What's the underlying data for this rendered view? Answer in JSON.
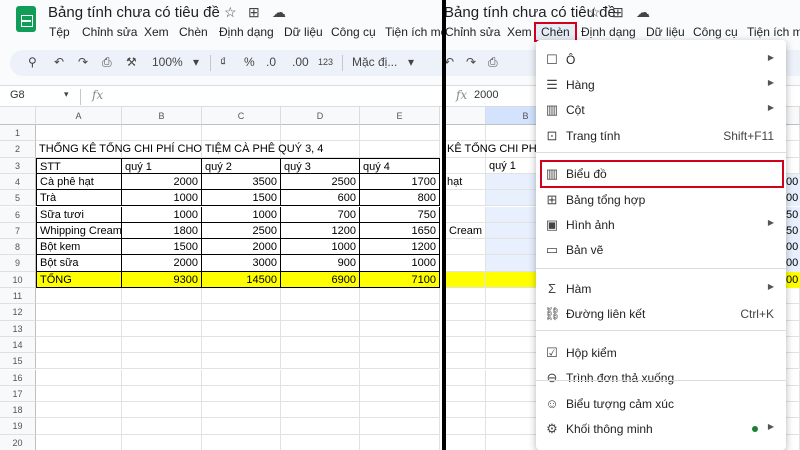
{
  "doc_title": "Bảng tính chưa có tiêu đề",
  "menu": [
    "Tệp",
    "Chỉnh sửa",
    "Xem",
    "Chèn",
    "Định dạng",
    "Dữ liệu",
    "Công cụ",
    "Tiện ích mở"
  ],
  "toolbar": {
    "zoom": "100%",
    "currency": "₫",
    "percent": "%",
    "dec_minus": ".0",
    "dec_plus": ".00",
    "number_format": "123",
    "font": "Mặc đị..."
  },
  "formula_bar": {
    "left_cell": "G8",
    "right_value": "2000",
    "fx_label": "fx"
  },
  "columns": [
    "A",
    "B",
    "C",
    "D",
    "E"
  ],
  "rows": [
    "1",
    "2",
    "3",
    "4",
    "5",
    "6",
    "7",
    "8",
    "9",
    "10",
    "11",
    "12",
    "13",
    "14",
    "15",
    "16",
    "17",
    "18",
    "19",
    "20"
  ],
  "sheet": {
    "heading": "THỐNG KÊ TỔNG CHI PHÍ CHO TIỆM CÀ PHÊ QUÝ 3, 4",
    "headers": [
      "STT",
      "quý 1",
      "quý 2",
      "quý 3",
      "quý 4"
    ],
    "data": [
      [
        "Cà phê hạt",
        "2000",
        "3500",
        "2500",
        "1700"
      ],
      [
        "Trà",
        "1000",
        "1500",
        "600",
        "800"
      ],
      [
        "Sữa tươi",
        "1000",
        "1000",
        "700",
        "750"
      ],
      [
        "Whipping Cream",
        "1800",
        "2500",
        "1200",
        "1650"
      ],
      [
        "Bột kem",
        "1500",
        "2000",
        "1000",
        "1200"
      ],
      [
        "Bột sữa",
        "2000",
        "3000",
        "900",
        "1000"
      ]
    ],
    "total": [
      "TỔNG",
      "9300",
      "14500",
      "6900",
      "7100"
    ]
  },
  "right_fragments": {
    "heading": "KÊ TỔNG CHI PHÍ C",
    "q1": "quý 1",
    "r4": "hạt",
    "r7": "Cream",
    "col_b_digits": [
      "00",
      "00",
      "50",
      "50",
      "00",
      "00",
      "00"
    ]
  },
  "insert_menu": {
    "items": [
      {
        "icon": "☐",
        "label": "Ô",
        "arrow": "▶",
        "shortcut": ""
      },
      {
        "icon": "☰",
        "label": "Hàng",
        "arrow": "▶",
        "shortcut": ""
      },
      {
        "icon": "▥",
        "label": "Cột",
        "arrow": "▶",
        "shortcut": ""
      },
      {
        "icon": "⊡",
        "label": "Trang tính",
        "arrow": "",
        "shortcut": "Shift+F11"
      },
      {
        "icon": "▥",
        "label": "Biểu đồ",
        "arrow": "",
        "shortcut": ""
      },
      {
        "icon": "⊞",
        "label": "Bảng tổng hợp",
        "arrow": "",
        "shortcut": ""
      },
      {
        "icon": "▣",
        "label": "Hình ảnh",
        "arrow": "▶",
        "shortcut": ""
      },
      {
        "icon": "▭",
        "label": "Bản vẽ",
        "arrow": "",
        "shortcut": ""
      },
      {
        "icon": "Σ",
        "label": "Hàm",
        "arrow": "▶",
        "shortcut": ""
      },
      {
        "icon": "⛓",
        "label": "Đường liên kết",
        "arrow": "",
        "shortcut": "Ctrl+K"
      },
      {
        "icon": "☑",
        "label": "Hộp kiểm",
        "arrow": "",
        "shortcut": ""
      },
      {
        "icon": "⊖",
        "label": "Trình đơn thả xuống",
        "arrow": "",
        "shortcut": ""
      },
      {
        "icon": "☺",
        "label": "Biểu tượng cảm xúc",
        "arrow": "",
        "shortcut": ""
      },
      {
        "icon": "⚙",
        "label": "Khối thông minh",
        "arrow": "▶",
        "shortcut": ""
      }
    ]
  },
  "colors": {
    "highlight_red": "#d0021b",
    "total_row_yellow": "#ffff00",
    "sheets_green": "#0f9d58"
  }
}
